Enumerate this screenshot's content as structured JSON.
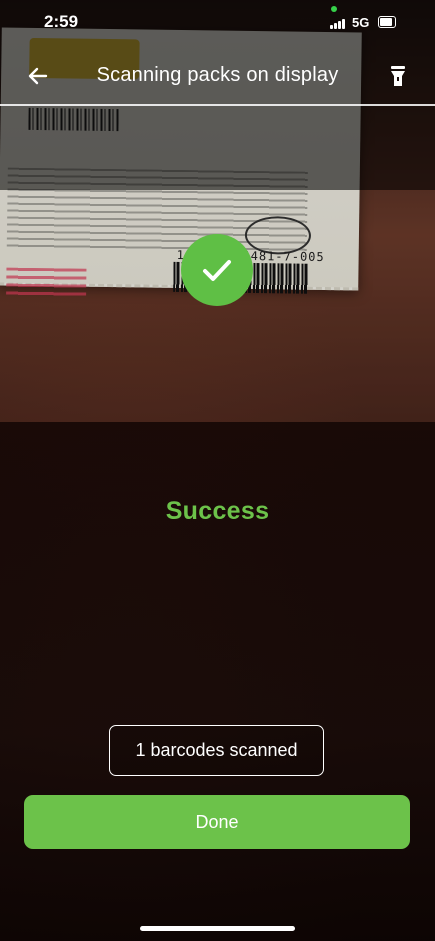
{
  "status_bar": {
    "time": "2:59",
    "network": "5G"
  },
  "header": {
    "title": "Scanning packs on display",
    "back_icon": "arrow-left-icon",
    "flashlight_icon": "flashlight-icon"
  },
  "ticket": {
    "number": "1469-1054481-7-005"
  },
  "scan_result": {
    "status_text": "Success",
    "icon": "checkmark-icon",
    "counter_text": "1 barcodes scanned"
  },
  "actions": {
    "done_label": "Done"
  },
  "colors": {
    "accent_green": "#6cc24a",
    "check_green": "#5fbf45",
    "text_white": "#ffffff"
  }
}
